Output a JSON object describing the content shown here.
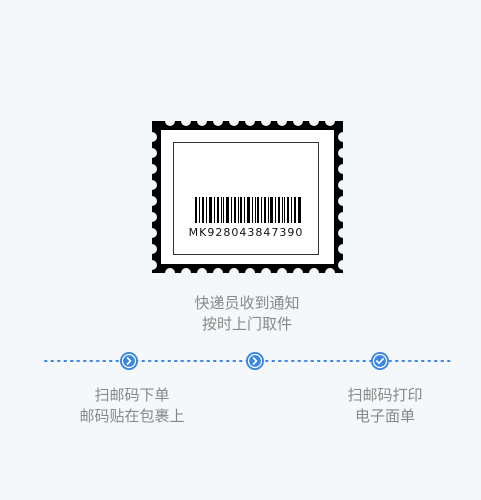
{
  "stamp": {
    "tracking_number": "MK928043847390"
  },
  "captions": {
    "courier": [
      "快递员收到通知",
      "按时上门取件"
    ],
    "left": [
      "扫邮码下单",
      "邮码贴在包裹上"
    ],
    "right": [
      "扫邮码打印",
      "电子面单"
    ]
  },
  "timeline": {
    "steps": [
      {
        "icon": "chevron-right-icon"
      },
      {
        "icon": "chevron-right-icon"
      },
      {
        "icon": "check-icon"
      }
    ]
  },
  "colors": {
    "accent": "#3b86e0",
    "text_muted": "#888888",
    "background": "#f5f8fa"
  }
}
